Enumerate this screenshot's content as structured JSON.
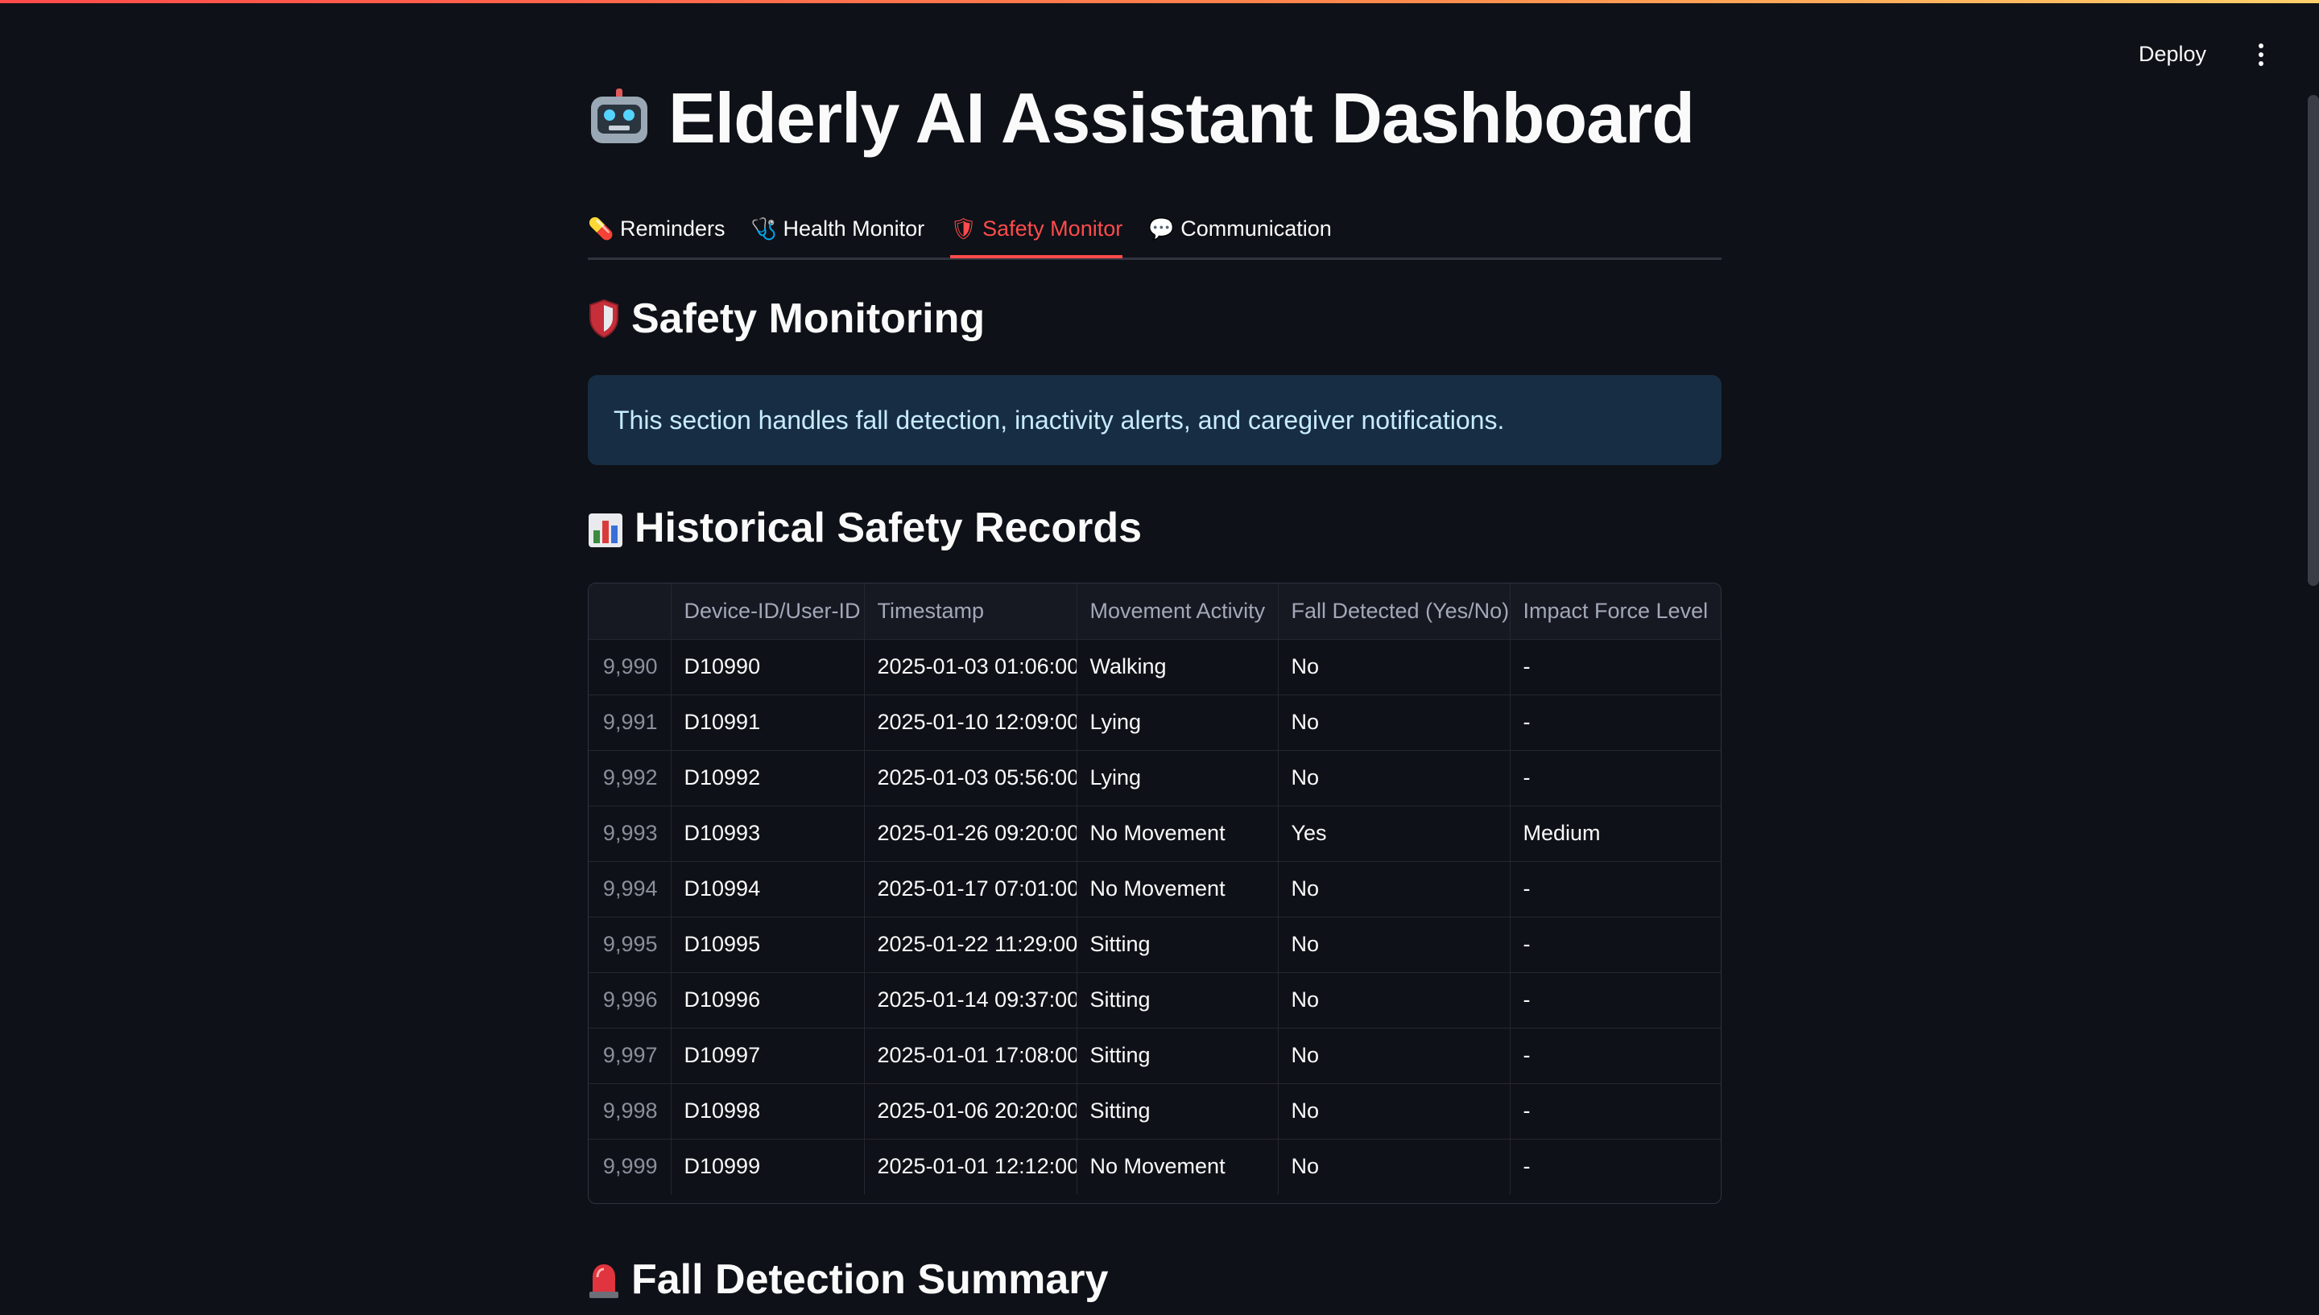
{
  "app": {
    "deploy_label": "Deploy",
    "menu_icon": "kebab-menu-icon"
  },
  "page": {
    "title": "Elderly AI Assistant Dashboard",
    "title_icon": "robot-icon"
  },
  "tabs": [
    {
      "label": "Reminders",
      "icon": "💊",
      "active": false
    },
    {
      "label": "Health Monitor",
      "icon": "🩺",
      "active": false
    },
    {
      "label": "Safety Monitor",
      "icon": "🛡",
      "active": true
    },
    {
      "label": "Communication",
      "icon": "💬",
      "active": false
    }
  ],
  "safety": {
    "heading": "Safety Monitoring",
    "info": "This section handles fall detection, inactivity alerts, and caregiver notifications.",
    "records_heading": "Historical Safety Records",
    "fall_summary_heading": "Fall Detection Summary"
  },
  "table": {
    "columns": [
      "",
      "Device-ID/User-ID",
      "Timestamp",
      "Movement Activity",
      "Fall Detected (Yes/No)",
      "Impact Force Level"
    ],
    "rows": [
      [
        "9,990",
        "D10990",
        "2025-01-03 01:06:00",
        "Walking",
        "No",
        "-"
      ],
      [
        "9,991",
        "D10991",
        "2025-01-10 12:09:00",
        "Lying",
        "No",
        "-"
      ],
      [
        "9,992",
        "D10992",
        "2025-01-03 05:56:00",
        "Lying",
        "No",
        "-"
      ],
      [
        "9,993",
        "D10993",
        "2025-01-26 09:20:00",
        "No Movement",
        "Yes",
        "Medium"
      ],
      [
        "9,994",
        "D10994",
        "2025-01-17 07:01:00",
        "No Movement",
        "No",
        "-"
      ],
      [
        "9,995",
        "D10995",
        "2025-01-22 11:29:00",
        "Sitting",
        "No",
        "-"
      ],
      [
        "9,996",
        "D10996",
        "2025-01-14 09:37:00",
        "Sitting",
        "No",
        "-"
      ],
      [
        "9,997",
        "D10997",
        "2025-01-01 17:08:00",
        "Sitting",
        "No",
        "-"
      ],
      [
        "9,998",
        "D10998",
        "2025-01-06 20:20:00",
        "Sitting",
        "No",
        "-"
      ],
      [
        "9,999",
        "D10999",
        "2025-01-01 12:12:00",
        "No Movement",
        "No",
        "-"
      ]
    ]
  },
  "colors": {
    "background": "#0e1117",
    "accent": "#ff4b4b",
    "info_bg": "#172d43",
    "info_text": "#c7ebff"
  }
}
